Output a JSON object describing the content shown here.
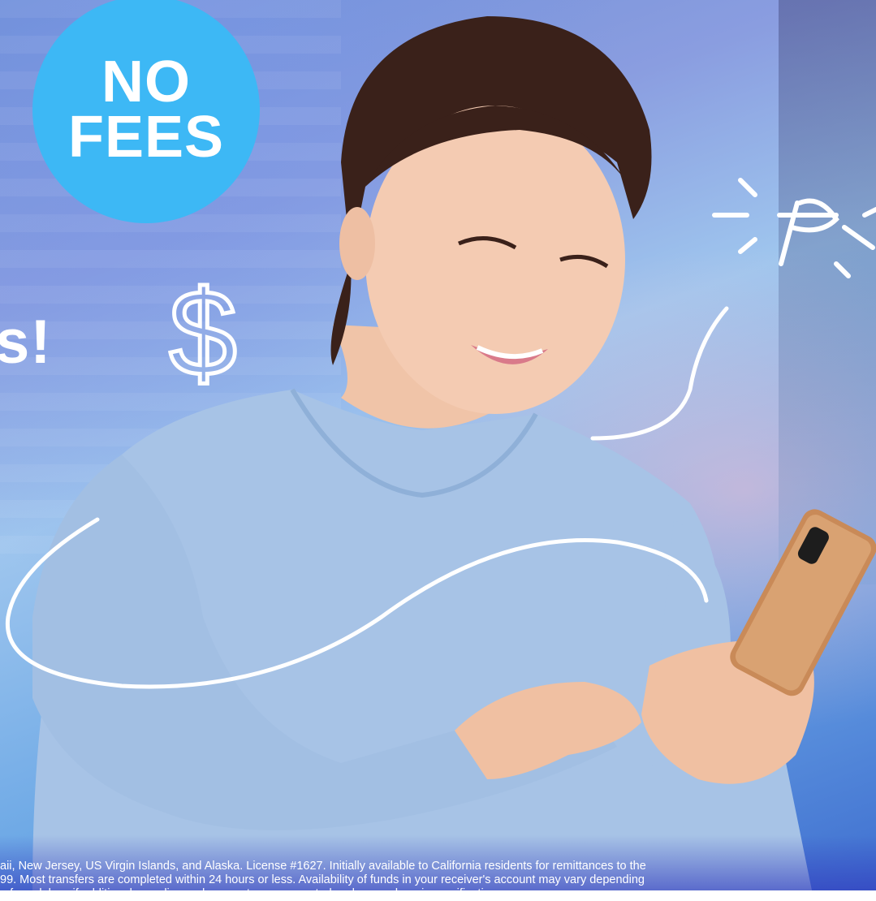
{
  "badge": {
    "line1": "NO",
    "line2": "FEES",
    "color": "#3db8f5"
  },
  "headline": {
    "visible_fragment": "s!"
  },
  "doodles": {
    "dollar_sign": "$"
  },
  "disclaimer": {
    "line1": "aii, New Jersey, US Virgin Islands, and Alaska. License #1627. Initially available to California residents for remittances to the",
    "line2": "99. Most transfers are completed within 24 hours or less. Availability of funds in your receiver's account may vary depending",
    "line3": "o face delays if additional compliance documents are requested and are undergoing verification."
  },
  "icons": [
    "sparkle-doodle-icon",
    "scribble-loop-icon",
    "dollar-sign-doodle-icon"
  ],
  "colors": {
    "accent": "#3db8f5",
    "text": "#ffffff"
  }
}
